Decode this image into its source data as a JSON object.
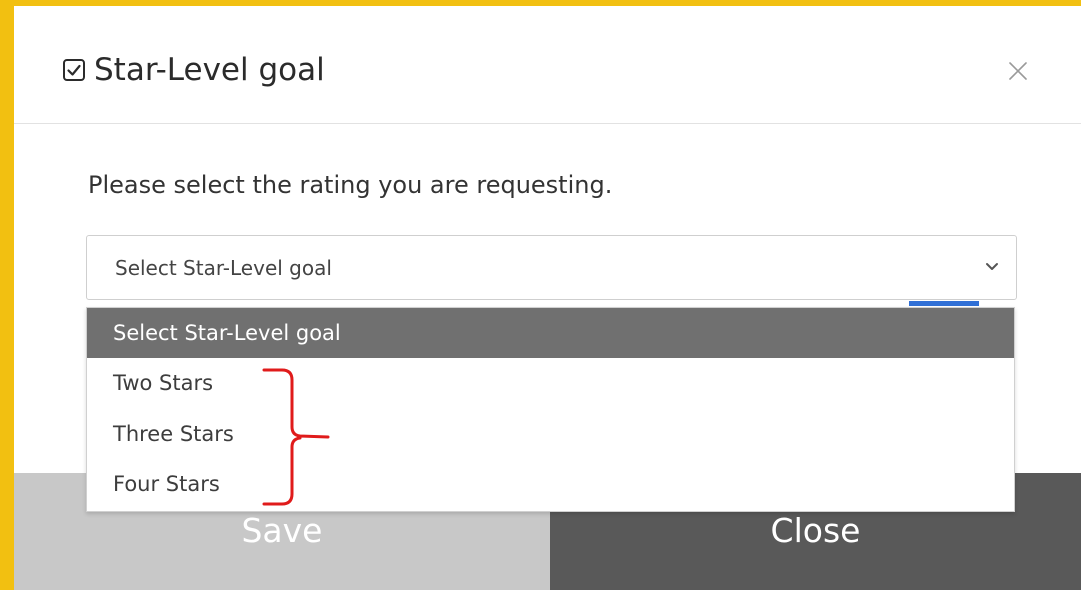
{
  "dialog": {
    "title": "Star-Level goal",
    "title_icon": "checkbox-check-icon",
    "close_icon": "close-icon",
    "prompt": "Please select the rating you are requesting.",
    "select": {
      "value": "Select Star-Level goal",
      "chevron_icon": "chevron-down-icon"
    },
    "options": [
      {
        "label": "Select Star-Level goal",
        "selected": true
      },
      {
        "label": "Two Stars",
        "selected": false
      },
      {
        "label": "Three Stars",
        "selected": false
      },
      {
        "label": "Four Stars",
        "selected": false
      }
    ],
    "footer": {
      "save_label": "Save",
      "close_label": "Close"
    }
  },
  "annotation": {
    "shape": "red-curly-bracket"
  },
  "colors": {
    "frame_accent": "#f2c011",
    "selected_option_bg": "#707070",
    "save_button_bg": "#c8c8c8",
    "close_button_bg": "#595959",
    "annotation_red": "#e01b1b"
  }
}
